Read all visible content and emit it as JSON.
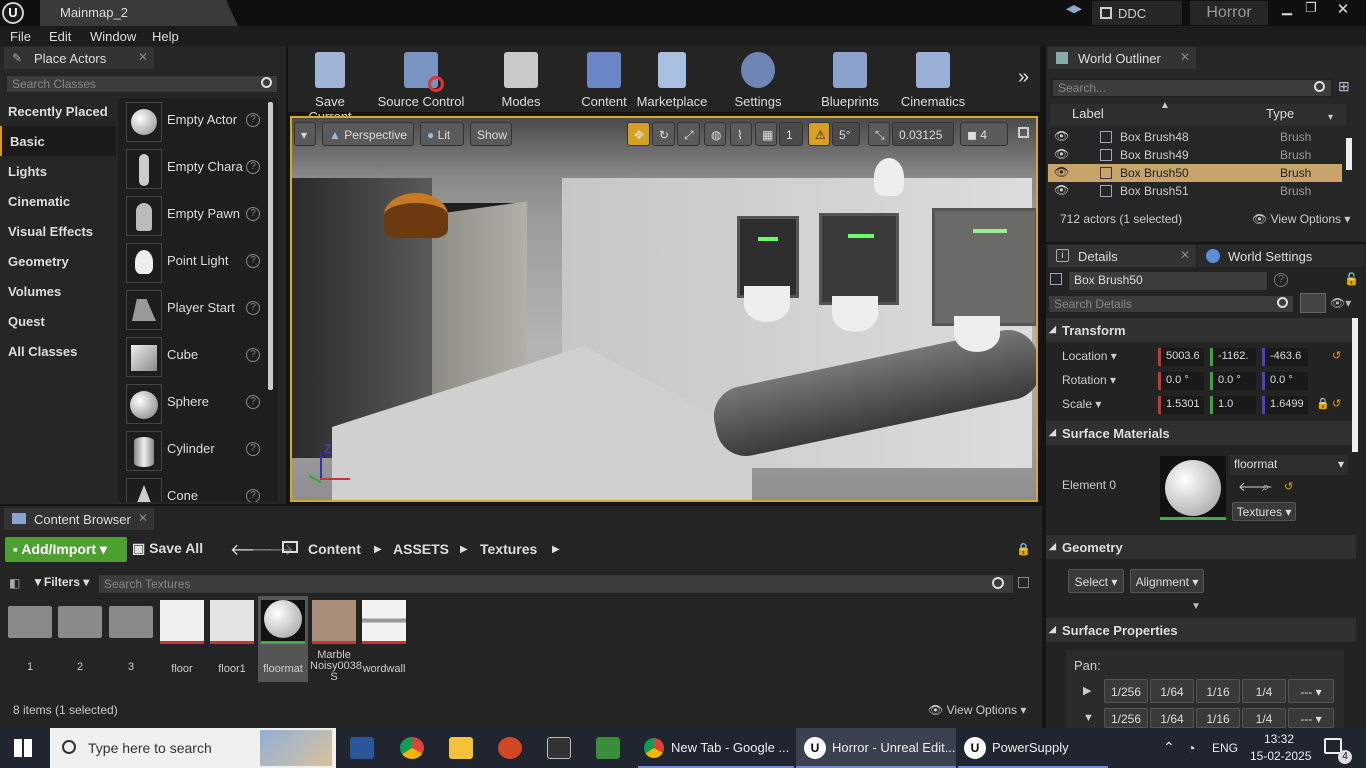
{
  "window": {
    "tab_title": "Mainmap_2",
    "ddc_label": "DDC",
    "project_name": "Horror",
    "min": "▁",
    "max": "❐",
    "close": "✕"
  },
  "menu": [
    "File",
    "Edit",
    "Window",
    "Help"
  ],
  "place_actors": {
    "title": "Place Actors",
    "search_placeholder": "Search Classes",
    "categories": [
      "Recently Placed",
      "Basic",
      "Lights",
      "Cinematic",
      "Visual Effects",
      "Geometry",
      "Volumes",
      "Quest",
      "All Classes"
    ],
    "selected_category": "Basic",
    "actors": [
      "Empty Actor",
      "Empty Chara",
      "Empty Pawn",
      "Point Light",
      "Player Start",
      "Cube",
      "Sphere",
      "Cylinder",
      "Cone"
    ]
  },
  "toolbar": [
    "Save Current",
    "Source Control",
    "Modes",
    "Content",
    "Marketplace",
    "Settings",
    "Blueprints",
    "Cinematics"
  ],
  "viewport": {
    "view_mode": "Perspective",
    "lighting": "Lit",
    "show": "Show",
    "grid_snap": "1",
    "rotation_snap": "5°",
    "scale_snap": "0.03125",
    "camera_speed": "4",
    "axis_z": "Z"
  },
  "world_outliner": {
    "title": "World Outliner",
    "search_placeholder": "Search...",
    "col_label": "Label",
    "col_type": "Type",
    "rows": [
      {
        "label": "Box Brush48",
        "type": "Brush"
      },
      {
        "label": "Box Brush49",
        "type": "Brush"
      },
      {
        "label": "Box Brush50",
        "type": "Brush"
      },
      {
        "label": "Box Brush51",
        "type": "Brush"
      }
    ],
    "status": "712 actors (1 selected)",
    "view_options": "View Options"
  },
  "details": {
    "tab_details": "Details",
    "tab_world": "World Settings",
    "object_name": "Box Brush50",
    "search_placeholder": "Search Details",
    "transform": "Transform",
    "location_label": "Location",
    "location": [
      "5003.6",
      "-1162.",
      "-463.6"
    ],
    "rotation_label": "Rotation",
    "rotation": [
      "0.0 °",
      "0.0 °",
      "0.0 °"
    ],
    "scale_label": "Scale",
    "scale": [
      "1.5301",
      "1.0",
      "1.6499"
    ],
    "surface_materials": "Surface Materials",
    "element_label": "Element 0",
    "material": "floormat",
    "textures_btn": "Textures",
    "geometry": "Geometry",
    "select_btn": "Select",
    "alignment_btn": "Alignment",
    "surface_properties": "Surface Properties",
    "pan_label": "Pan:",
    "pan_values": [
      "1/256",
      "1/64",
      "1/16",
      "1/4",
      "---"
    ]
  },
  "content_browser": {
    "title": "Content Browser",
    "add_import": "Add/Import",
    "save_all": "Save All",
    "path": [
      "Content",
      "ASSETS",
      "Textures"
    ],
    "filters": "Filters",
    "search_placeholder": "Search Textures",
    "assets": [
      "1",
      "2",
      "3",
      "floor",
      "floor1",
      "floormat",
      "Marble Noisy0038 S",
      "wordwall"
    ],
    "status": "8 items (1 selected)",
    "view_options": "View Options"
  },
  "taskbar": {
    "search_placeholder": "Type here to search",
    "chrome_item": "New Tab - Google ...",
    "unreal_item": "Horror - Unreal Edit...",
    "powersupply_item": "PowerSupply",
    "lang": "ENG",
    "time": "13:32",
    "date": "15-02-2025",
    "notifications": "4"
  }
}
